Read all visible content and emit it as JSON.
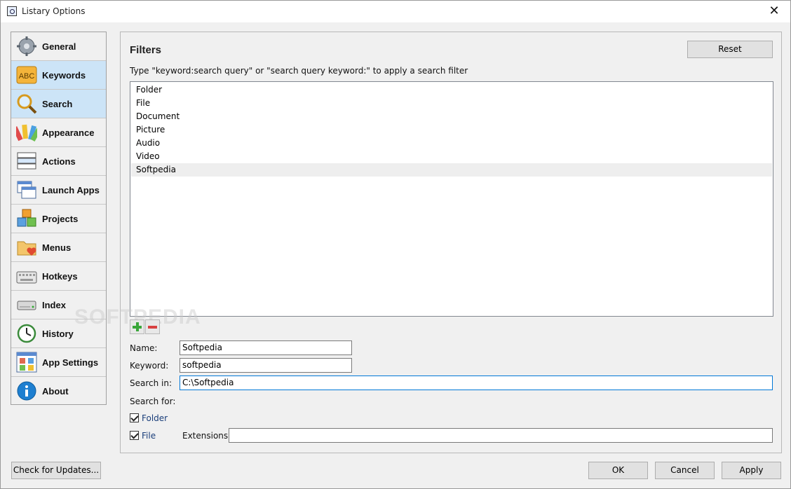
{
  "window": {
    "title": "Listary Options",
    "close_glyph": "✕"
  },
  "sidebar": {
    "items": [
      {
        "label": "General",
        "icon": "gear-icon",
        "active": false
      },
      {
        "label": "Keywords",
        "icon": "abc-icon",
        "active": true
      },
      {
        "label": "Search",
        "icon": "magnifier-icon",
        "active": true
      },
      {
        "label": "Appearance",
        "icon": "palette-icon",
        "active": false
      },
      {
        "label": "Actions",
        "icon": "actions-icon",
        "active": false
      },
      {
        "label": "Launch Apps",
        "icon": "windows-icon",
        "active": false
      },
      {
        "label": "Projects",
        "icon": "cubes-icon",
        "active": false
      },
      {
        "label": "Menus",
        "icon": "folder-heart-icon",
        "active": false
      },
      {
        "label": "Hotkeys",
        "icon": "keyboard-icon",
        "active": false
      },
      {
        "label": "Index",
        "icon": "drive-icon",
        "active": false
      },
      {
        "label": "History",
        "icon": "clock-icon",
        "active": false
      },
      {
        "label": "App Settings",
        "icon": "app-grid-icon",
        "active": false
      },
      {
        "label": "About",
        "icon": "info-icon",
        "active": false
      }
    ]
  },
  "filters": {
    "heading": "Filters",
    "reset_label": "Reset",
    "hint": "Type \"keyword:search query\" or \"search query keyword:\" to apply a search filter",
    "items": [
      "Folder",
      "File",
      "Document",
      "Picture",
      "Audio",
      "Video",
      "Softpedia"
    ],
    "selected_index": 6,
    "add_icon": "plus-icon",
    "remove_icon": "minus-icon"
  },
  "form": {
    "name_label": "Name:",
    "name_value": "Softpedia",
    "keyword_label": "Keyword:",
    "keyword_value": "softpedia",
    "search_in_label": "Search in:",
    "search_in_value": "C:\\Softpedia",
    "search_for_label": "Search for:",
    "folder_label": "Folder",
    "folder_checked": true,
    "file_label": "File",
    "file_checked": true,
    "extensions_label": "Extensions:",
    "extensions_value": ""
  },
  "footer": {
    "check_updates_label": "Check for Updates...",
    "ok_label": "OK",
    "cancel_label": "Cancel",
    "apply_label": "Apply"
  },
  "colors": {
    "accent": "#0078d7",
    "active_nav": "#cce4f7",
    "selected_row": "#eeeeee"
  },
  "watermark": "SOFTPEDIA"
}
